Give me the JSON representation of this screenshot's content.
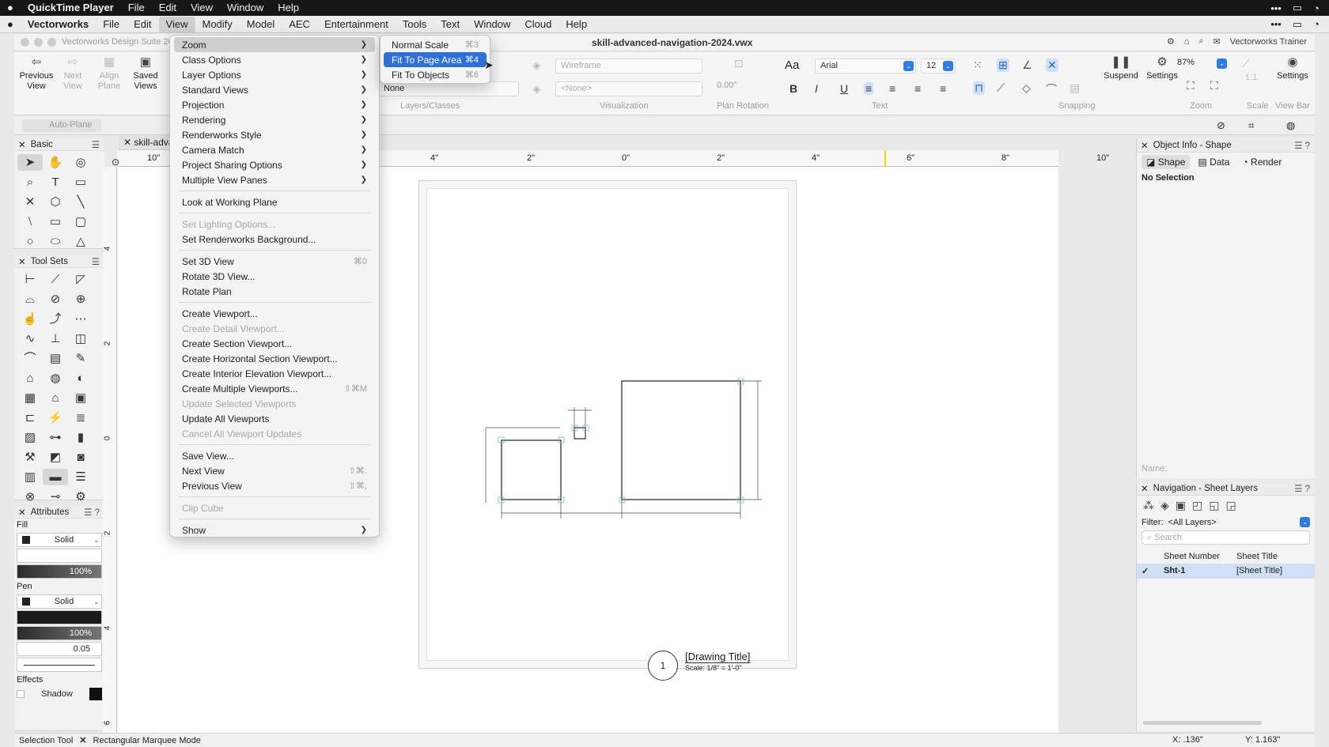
{
  "system_menu": {
    "app_name": "QuickTime Player",
    "items": [
      "File",
      "Edit",
      "View",
      "Window",
      "Help"
    ]
  },
  "app_menu": {
    "app_name": "Vectorworks",
    "items": [
      "File",
      "Edit",
      "View",
      "Modify",
      "Model",
      "AEC",
      "Entertainment",
      "Tools",
      "Text",
      "Window",
      "Cloud",
      "Help"
    ]
  },
  "window": {
    "app_title": "Vectorworks Design Suite 20",
    "doc_title": "skill-advanced-navigation-2024.vwx",
    "user": "Vectorworks Trainer"
  },
  "toolbar": {
    "previous_view": "Previous View",
    "next_view": "Next View",
    "align_plane": "Align Plane",
    "saved_views": "Saved Views",
    "layer_field": "None",
    "render_mode": "Wireframe",
    "viz_field": "<None>",
    "plan_rotation_value": "0.00°",
    "font_name": "Arial",
    "font_size": "12",
    "suspend": "Suspend",
    "settings": "Settings",
    "zoom_value": "87%",
    "scale_value": "1:1",
    "settings2": "Settings",
    "groups": {
      "layers": "Layers/Classes",
      "visualization": "Visualization",
      "plan_rotation": "Plan Rotation",
      "text": "Text",
      "snapping": "Snapping",
      "zoom": "Zoom",
      "scale": "Scale",
      "view_bar": "View Bar"
    },
    "auto_plane": "Auto-Plane"
  },
  "basic_palette": {
    "title": "Basic"
  },
  "toolsets_palette": {
    "title": "Tool Sets"
  },
  "attributes": {
    "title": "Attributes",
    "fill_label": "Fill",
    "fill_style": "Solid",
    "fill_opacity": "100%",
    "pen_label": "Pen",
    "pen_style": "Solid",
    "pen_opacity": "100%",
    "line_weight": "0.05",
    "effects_label": "Effects",
    "shadow_label": "Shadow"
  },
  "doc_tab": "skill-adva",
  "ruler": {
    "top": [
      "10\"",
      "4\"",
      "2\"",
      "0\"",
      "2\"",
      "4\"",
      "6\"",
      "8\"",
      "10\""
    ],
    "left": [
      "4",
      "2",
      "0",
      "2",
      "4",
      "6"
    ]
  },
  "drawing": {
    "title_number": "1",
    "title_text": "[Drawing Title]",
    "scale_text": "Scale: 1/8\" = 1'-0\""
  },
  "object_info": {
    "title": "Object Info - Shape",
    "tabs": [
      "Shape",
      "Data",
      "Render"
    ],
    "status": "No Selection",
    "name_label": "Name:"
  },
  "navigation": {
    "title": "Navigation - Sheet Layers",
    "filter_label": "Filter:",
    "filter_value": "<All Layers>",
    "search_placeholder": "Search",
    "col_number": "Sheet Number",
    "col_title": "Sheet Title",
    "rows": [
      {
        "number": "Sht-1",
        "title": "[Sheet Title]"
      }
    ]
  },
  "status": {
    "tool": "Selection Tool",
    "mode": "Rectangular Marquee Mode",
    "x": "X: .136\"",
    "y": "Y: 1.163\""
  },
  "view_menu": {
    "items": [
      {
        "label": "Zoom",
        "submenu": true,
        "state": "hover"
      },
      {
        "label": "Class Options",
        "submenu": true
      },
      {
        "label": "Layer Options",
        "submenu": true
      },
      {
        "label": "Standard Views",
        "submenu": true
      },
      {
        "label": "Projection",
        "submenu": true
      },
      {
        "label": "Rendering",
        "submenu": true
      },
      {
        "label": "Renderworks Style",
        "submenu": true
      },
      {
        "label": "Camera Match",
        "submenu": true
      },
      {
        "label": "Project Sharing Options",
        "submenu": true
      },
      {
        "label": "Multiple View Panes",
        "submenu": true
      },
      {
        "separator": true
      },
      {
        "label": "Look at Working Plane"
      },
      {
        "separator": true
      },
      {
        "label": "Set Lighting Options...",
        "disabled": true
      },
      {
        "label": "Set Renderworks Background..."
      },
      {
        "separator": true
      },
      {
        "label": "Set 3D View",
        "shortcut": "⌘0"
      },
      {
        "label": "Rotate 3D View..."
      },
      {
        "label": "Rotate Plan"
      },
      {
        "separator": true
      },
      {
        "label": "Create Viewport..."
      },
      {
        "label": "Create Detail Viewport...",
        "disabled": true
      },
      {
        "label": "Create Section Viewport..."
      },
      {
        "label": "Create Horizontal Section Viewport..."
      },
      {
        "label": "Create Interior Elevation Viewport..."
      },
      {
        "label": "Create Multiple Viewports...",
        "shortcut": "⇧⌘M"
      },
      {
        "label": "Update Selected Viewports",
        "disabled": true
      },
      {
        "label": "Update All Viewports"
      },
      {
        "label": "Cancel All Viewport Updates",
        "disabled": true
      },
      {
        "separator": true
      },
      {
        "label": "Save View..."
      },
      {
        "label": "Next View",
        "shortcut": "⇧⌘."
      },
      {
        "label": "Previous View",
        "shortcut": "⇧⌘,"
      },
      {
        "separator": true
      },
      {
        "label": "Clip Cube",
        "disabled": true
      },
      {
        "separator": true
      },
      {
        "label": "Show",
        "submenu": true
      }
    ]
  },
  "zoom_submenu": {
    "items": [
      {
        "label": "Normal Scale",
        "shortcut": "⌘3"
      },
      {
        "label": "Fit To Page Area",
        "shortcut": "⌘4",
        "selected": true
      },
      {
        "label": "Fit To Objects",
        "shortcut": "⌘6"
      }
    ]
  },
  "colors": {
    "accent": "#2f6fd6",
    "menu_bg": "#f4f4f4",
    "system_bar": "#161616"
  }
}
